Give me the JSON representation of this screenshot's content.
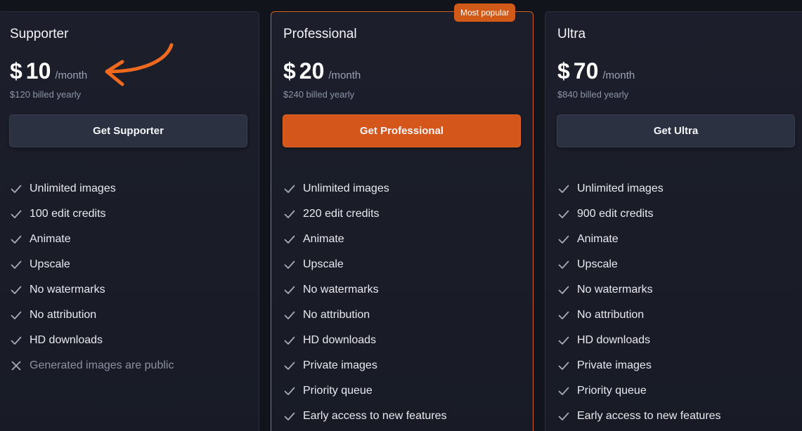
{
  "accent_color": "#d5561a",
  "plans": [
    {
      "name": "Supporter",
      "currency": "$",
      "amount": "10",
      "period": "/month",
      "billed": "$120 billed yearly",
      "cta": "Get Supporter",
      "features": [
        {
          "text": "Unlimited images",
          "icon": "check-icon"
        },
        {
          "text": "100 edit credits",
          "icon": "check-icon"
        },
        {
          "text": "Animate",
          "icon": "check-icon"
        },
        {
          "text": "Upscale",
          "icon": "check-icon"
        },
        {
          "text": "No watermarks",
          "icon": "check-icon"
        },
        {
          "text": "No attribution",
          "icon": "check-icon"
        },
        {
          "text": "HD downloads",
          "icon": "check-icon"
        },
        {
          "text": "Generated images are public",
          "icon": "x-icon"
        }
      ]
    },
    {
      "name": "Professional",
      "badge": "Most popular",
      "currency": "$",
      "amount": "20",
      "period": "/month",
      "billed": "$240 billed yearly",
      "cta": "Get Professional",
      "features": [
        {
          "text": "Unlimited images",
          "icon": "check-icon"
        },
        {
          "text": "220 edit credits",
          "icon": "check-icon"
        },
        {
          "text": "Animate",
          "icon": "check-icon"
        },
        {
          "text": "Upscale",
          "icon": "check-icon"
        },
        {
          "text": "No watermarks",
          "icon": "check-icon"
        },
        {
          "text": "No attribution",
          "icon": "check-icon"
        },
        {
          "text": "HD downloads",
          "icon": "check-icon"
        },
        {
          "text": "Private images",
          "icon": "check-icon"
        },
        {
          "text": "Priority queue",
          "icon": "check-icon"
        },
        {
          "text": "Early access to new features",
          "icon": "check-icon"
        }
      ]
    },
    {
      "name": "Ultra",
      "currency": "$",
      "amount": "70",
      "period": "/month",
      "billed": "$840 billed yearly",
      "cta": "Get Ultra",
      "features": [
        {
          "text": "Unlimited images",
          "icon": "check-icon"
        },
        {
          "text": "900 edit credits",
          "icon": "check-icon"
        },
        {
          "text": "Animate",
          "icon": "check-icon"
        },
        {
          "text": "Upscale",
          "icon": "check-icon"
        },
        {
          "text": "No watermarks",
          "icon": "check-icon"
        },
        {
          "text": "No attribution",
          "icon": "check-icon"
        },
        {
          "text": "HD downloads",
          "icon": "check-icon"
        },
        {
          "text": "Private images",
          "icon": "check-icon"
        },
        {
          "text": "Priority queue",
          "icon": "check-icon"
        },
        {
          "text": "Early access to new features",
          "icon": "check-icon"
        }
      ]
    }
  ]
}
